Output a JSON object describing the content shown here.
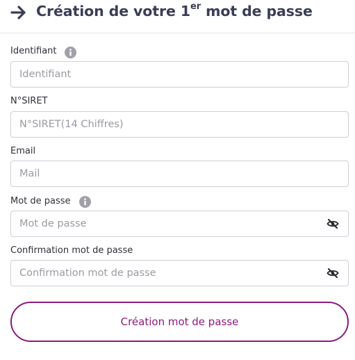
{
  "header": {
    "title_prefix": "Création de votre 1",
    "title_sup": "er",
    "title_suffix": " mot de passe",
    "arrow_icon": "arrow-right-icon"
  },
  "fields": {
    "identifiant": {
      "label": "Identifiant",
      "placeholder": "Identifiant",
      "value": ""
    },
    "siret": {
      "label": "N°SIRET",
      "placeholder": "N°SIRET(14 Chiffres)",
      "value": ""
    },
    "email": {
      "label": "Email",
      "placeholder": "Mail",
      "value": ""
    },
    "password": {
      "label": "Mot de passe",
      "placeholder": "Mot de passe",
      "value": ""
    },
    "confirm": {
      "label": "Confirmation mot de passe",
      "placeholder": "Confirmation mot de passe",
      "value": ""
    }
  },
  "icons": {
    "info": "info-icon",
    "eye": "eye-slash-icon"
  },
  "submit": {
    "label": "Création mot de passe"
  },
  "colors": {
    "accent": "#8b1a7d",
    "title": "#3a3d55",
    "border": "#cfcfd6",
    "placeholder": "#9a9aa3",
    "info_icon": "#a0a0a8"
  }
}
